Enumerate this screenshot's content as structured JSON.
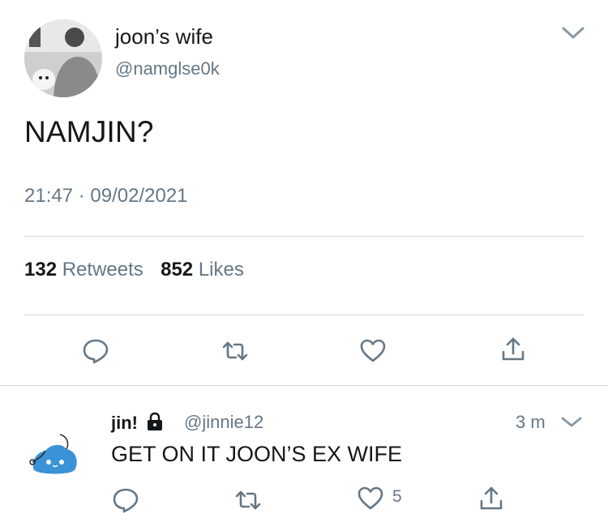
{
  "tweet": {
    "display_name": "joon’s wife",
    "handle": "@namglse0k",
    "text": "NAMJIN?",
    "time": "21:47",
    "date": "09/02/2021",
    "retweets_count": "132",
    "retweets_label": "Retweets",
    "likes_count": "852",
    "likes_label": "Likes"
  },
  "reply": {
    "display_name": "jin!",
    "handle": "@jinnie12",
    "time": "3 m",
    "text": "GET ON IT JOON’S EX WIFE",
    "likes_count": "5"
  },
  "icons": {
    "reply": "speech-bubble-icon",
    "retweet": "retweet-icon",
    "like": "heart-icon",
    "share": "share-icon",
    "menu": "chevron-down-icon",
    "protected": "lock-icon"
  },
  "colors": {
    "text": "#14171a",
    "secondary": "#657786",
    "divider": "#cfd9de",
    "accent": "#1da1f2"
  }
}
